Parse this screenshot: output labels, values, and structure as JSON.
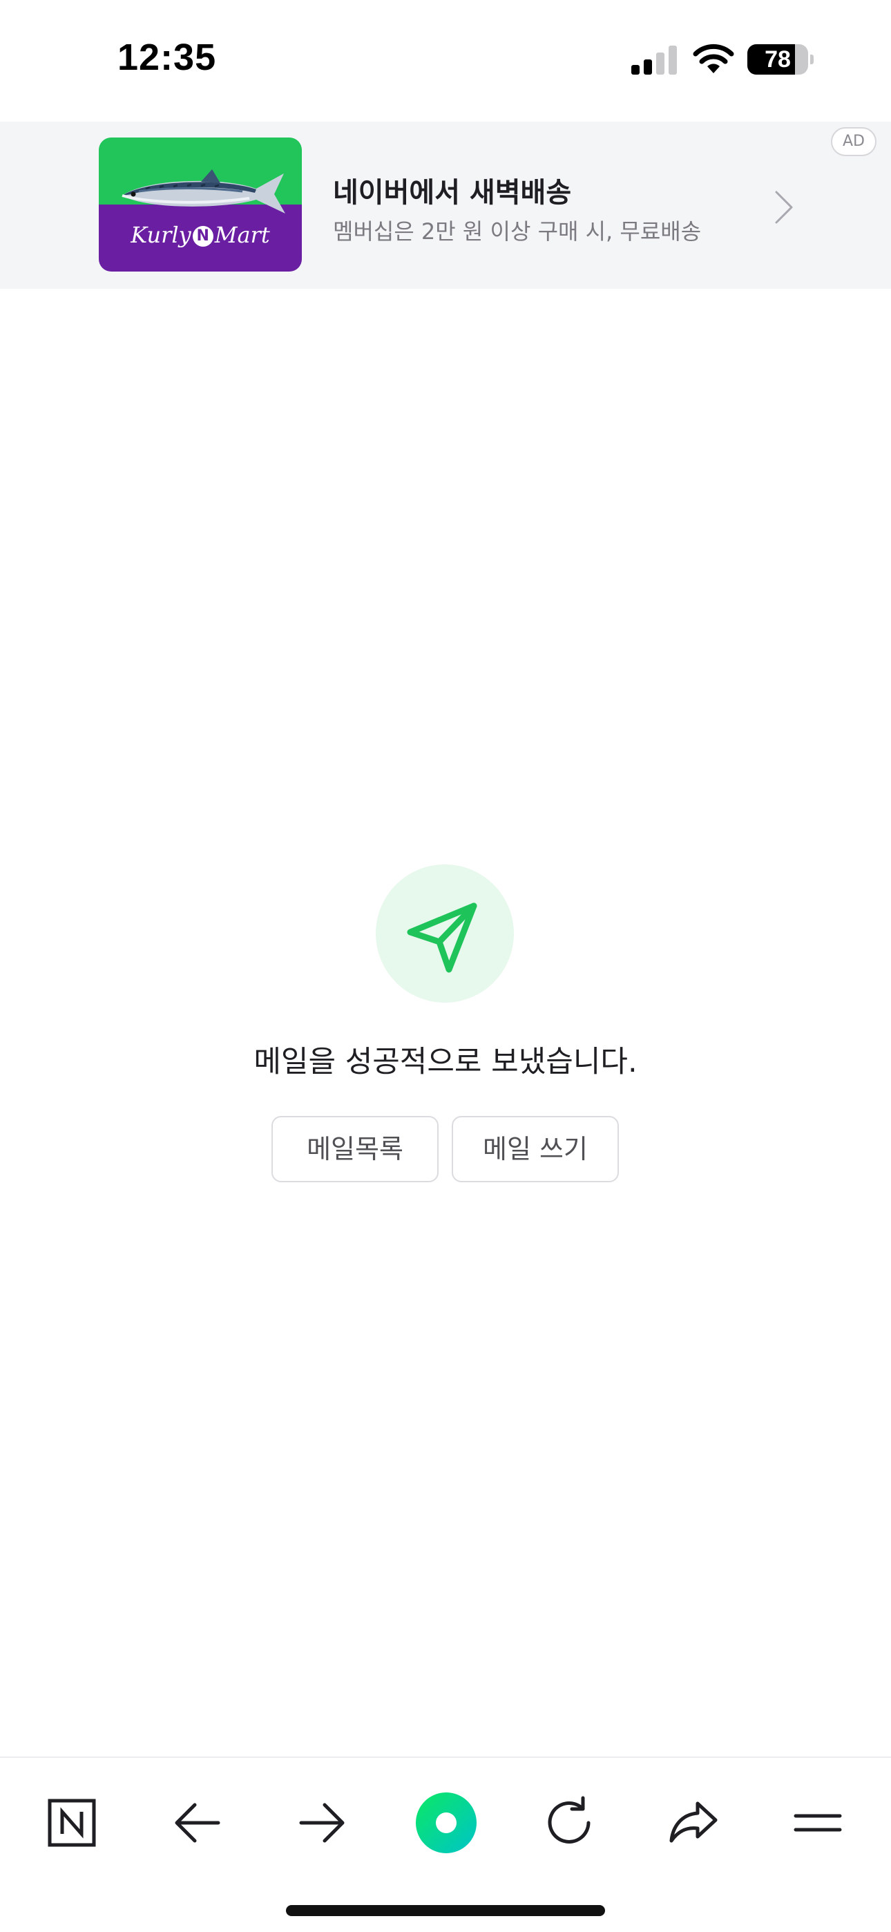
{
  "status_bar": {
    "time": "12:35",
    "battery_level": "78",
    "battery_fraction": 0.78
  },
  "ad": {
    "badge": "AD",
    "title": "네이버에서 새벽배송",
    "subtitle": "멤버십은 2만 원 이상 구매 시, 무료배송",
    "brand_logo_left": "Kurly",
    "brand_logo_n": "N",
    "brand_logo_right": "Mart",
    "colors": {
      "thumb_top": "#22c55a",
      "thumb_bottom": "#6a1fa2",
      "background": "#f4f5f7"
    }
  },
  "main": {
    "icon": "paper-plane-icon",
    "message": "메일을 성공적으로 보냈습니다.",
    "buttons": {
      "mail_list": "메일목록",
      "compose": "메일 쓰기"
    },
    "colors": {
      "accent": "#1ec35a",
      "icon_bg": "#e7f8ec"
    }
  },
  "toolbar": {
    "items": [
      "naver-home-icon",
      "arrow-left-icon",
      "arrow-right-icon",
      "green-dot-icon",
      "reload-icon",
      "share-icon",
      "menu-icon"
    ]
  }
}
